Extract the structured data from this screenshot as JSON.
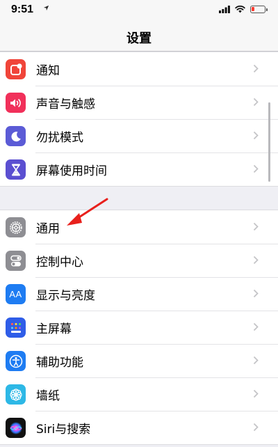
{
  "status_bar": {
    "time": "9:51"
  },
  "nav": {
    "title": "设置"
  },
  "colors": {
    "notifications": "#f0453a",
    "sounds": "#f1305a",
    "dnd": "#5b5bd6",
    "screentime": "#5b4fd1",
    "general": "#8e8e93",
    "control_center": "#8e8e93",
    "display": "#1e7cf2",
    "home_screen": "#2f5de8",
    "accessibility": "#1e7cf2",
    "wallpaper": "#2db8e6",
    "battery": "#ff3b30",
    "arrow": "#e8201c"
  },
  "groups": [
    {
      "items": [
        {
          "label": "通知",
          "icon": "notifications-icon"
        },
        {
          "label": "声音与触感",
          "icon": "sounds-icon"
        },
        {
          "label": "勿扰模式",
          "icon": "moon-icon"
        },
        {
          "label": "屏幕使用时间",
          "icon": "hourglass-icon"
        }
      ]
    },
    {
      "items": [
        {
          "label": "通用",
          "icon": "gear-icon"
        },
        {
          "label": "控制中心",
          "icon": "toggles-icon"
        },
        {
          "label": "显示与亮度",
          "icon": "display-aa-icon",
          "icon_text": "AA"
        },
        {
          "label": "主屏幕",
          "icon": "home-grid-icon"
        },
        {
          "label": "辅助功能",
          "icon": "accessibility-icon"
        },
        {
          "label": "墙纸",
          "icon": "flower-icon"
        },
        {
          "label": "Siri与搜索",
          "icon": "siri-icon"
        }
      ]
    }
  ]
}
